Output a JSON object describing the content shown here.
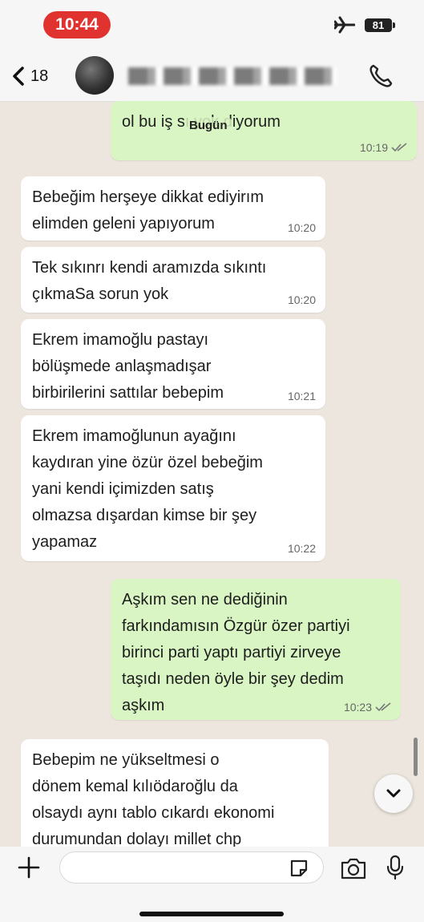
{
  "status_bar": {
    "time": "10:44",
    "battery": "81"
  },
  "header": {
    "unread_count": "18"
  },
  "chat": {
    "date_chip": "Bugün",
    "messages": [
      {
        "direction": "out",
        "text": "ol bu iş          sı yok diyorum",
        "time": "10:19",
        "read": true
      },
      {
        "direction": "in",
        "text": "Bebeğim herşeye dikkat ediyirım\nelimden geleni yapıyorum",
        "time": "10:20"
      },
      {
        "direction": "in",
        "text": "Tek sıkınrı kendi aramızda sıkıntı\nçıkmaSa sorun yok",
        "time": "10:20"
      },
      {
        "direction": "in",
        "text": "Ekrem imamoğlu pastayı\nbölüşmede anlaşmadışar\nbirbirilerini sattılar bebepim",
        "time": "10:21"
      },
      {
        "direction": "in",
        "text": "Ekrem imamoğlunun ayağını\nkaydıran yine özür özel bebeğim\nyani kendi içimizden satış\nolmazsa dışardan kimse bir şey\nyapamaz",
        "time": "10:22"
      },
      {
        "direction": "out",
        "text": "Aşkım sen ne dediğinin\nfarkındamısın Özgür özer partiyi\nbirinci parti yaptı  partiyi zirveye\ntaşıdı neden öyle bir şey dedim\naşkım",
        "time": "10:23",
        "read": true
      },
      {
        "direction": "in",
        "text": "Bebepim  ne yükseltmesi o\ndönem kemal kılıödaroğlu da\nolsaydı aynı tablo cıkardı ekonomi\ndurumundan dolayı millet chp",
        "time": ""
      }
    ]
  },
  "input": {
    "placeholder": ""
  },
  "colors": {
    "status_pill": "#e0332f",
    "incoming_bubble": "#ffffff",
    "outgoing_bubble": "#d8f5c3",
    "chat_background": "#ece6de"
  },
  "icons": [
    "airplane-icon",
    "back-icon",
    "call-icon",
    "read-ticks-icon",
    "chevron-down-icon",
    "plus-icon",
    "sticker-icon",
    "camera-icon",
    "mic-icon"
  ]
}
